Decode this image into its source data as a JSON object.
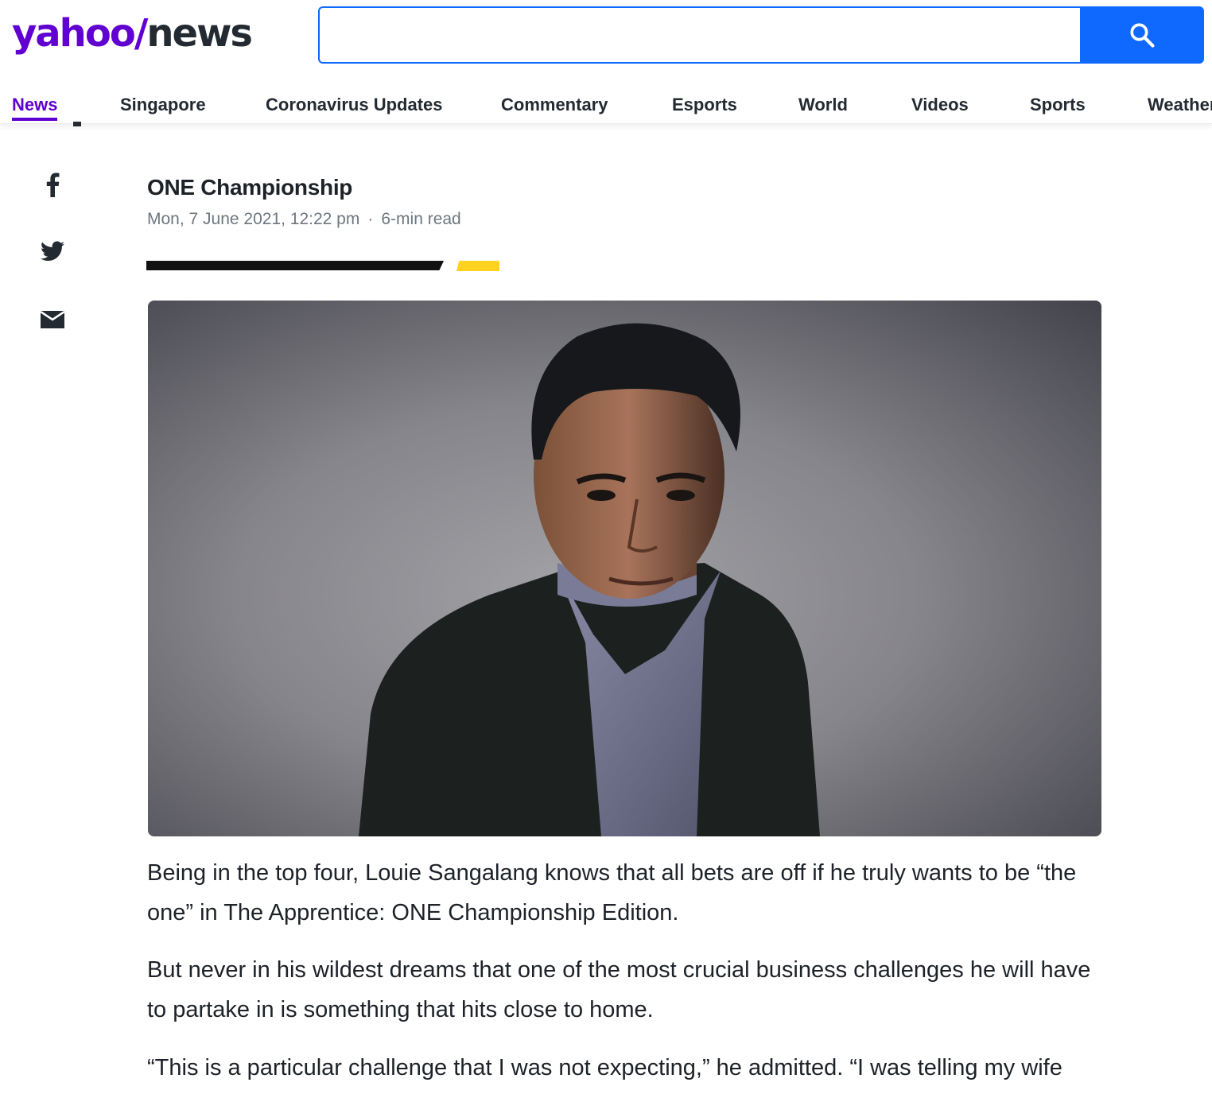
{
  "header": {
    "logo_yahoo": "yahoo",
    "logo_slash": "/",
    "logo_news": "news",
    "search": {
      "value": "",
      "placeholder": ""
    },
    "search_icon": "search-icon"
  },
  "nav": {
    "items": [
      {
        "label": "News",
        "active": true
      },
      {
        "label": "Singapore"
      },
      {
        "label": "Coronavirus Updates"
      },
      {
        "label": "Commentary"
      },
      {
        "label": "Esports"
      },
      {
        "label": "World"
      },
      {
        "label": "Videos"
      },
      {
        "label": "Sports"
      },
      {
        "label": "Weather"
      }
    ]
  },
  "share": {
    "icons": [
      "facebook-icon",
      "twitter-icon",
      "mail-icon"
    ]
  },
  "article": {
    "provider": "ONE Championship",
    "date": "Mon, 7 June 2021, 12:22 pm",
    "separator": "·",
    "read_time": "6-min read",
    "paragraphs": [
      "Being in the top four, Louie Sangalang knows that all bets are off if he truly wants to be “the one” in The Apprentice: ONE Championship Edition.",
      "But never in his wildest dreams that one of the most crucial business challenges he will have to partake in is something that hits close to home.",
      "“This is a particular challenge that I was not expecting,” he admitted. “I was telling my wife"
    ]
  },
  "colors": {
    "brand_purple": "#6001d2",
    "search_blue": "#0f69ff",
    "accent_yellow": "#ffd21f",
    "text_dark": "#232a31",
    "meta_gray": "#6e7780"
  }
}
